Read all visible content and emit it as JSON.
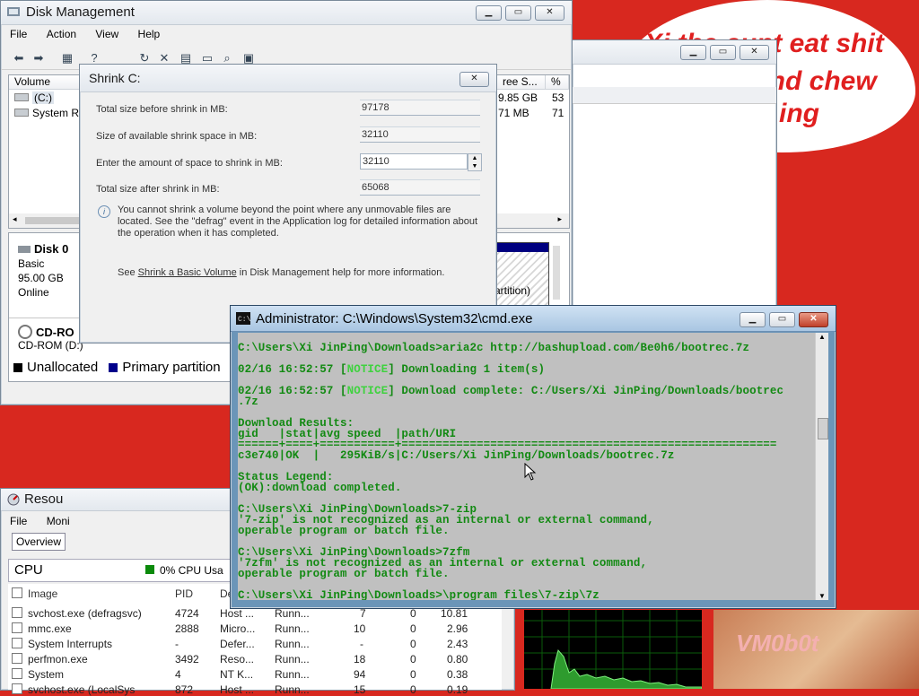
{
  "bubble": {
    "line1": "Xi the cunt eat shit",
    "line2": "and chew",
    "line3": "ing"
  },
  "watermark": "VM0b0t",
  "disk_management": {
    "title": "Disk Management",
    "menu": [
      "File",
      "Action",
      "View",
      "Help"
    ],
    "columns": [
      "Volume",
      "ree S...",
      "%"
    ],
    "rows": [
      {
        "volume": "(C:)",
        "free": "9.85 GB",
        "pct": "53"
      },
      {
        "volume": "System Re",
        "free": "71 MB",
        "pct": "71"
      }
    ],
    "disk0": {
      "name": "Disk 0",
      "type": "Basic",
      "size": "95.00 GB",
      "status": "Online"
    },
    "partition_label": "artition)",
    "cdrom": {
      "name": "CD-RO",
      "type": "CD-ROM (D:)"
    },
    "legend": [
      "Unallocated",
      "Primary partition"
    ]
  },
  "shrink": {
    "title": "Shrink C:",
    "rows": [
      {
        "label": "Total size before shrink in MB:",
        "value": "97178"
      },
      {
        "label": "Size of available shrink space in MB:",
        "value": "32110"
      },
      {
        "label": "Enter the amount of space to shrink in MB:",
        "value": "32110"
      },
      {
        "label": "Total size after shrink in MB:",
        "value": "65068"
      }
    ],
    "info": "You cannot shrink a volume beyond the point where any unmovable files are located. See the \"defrag\" event in the Application log for detailed information about the operation when it has completed.",
    "see_pre": "See ",
    "see_link": "Shrink a Basic Volume",
    "see_post": " in Disk Management help for more information."
  },
  "resource_monitor": {
    "title": "Resou",
    "menu": [
      "File",
      "Moni"
    ],
    "tab": "Overview",
    "cpu_label": "CPU",
    "cpu_usage": "0% CPU Usa",
    "columns": [
      "Image",
      "PID",
      "De"
    ],
    "processes": [
      {
        "image": "svchost.exe (defragsvc)",
        "pid": "4724",
        "desc": "Host ...",
        "status": "Runn...",
        "threads": "7",
        "cpu": "0",
        "avg": "10.81"
      },
      {
        "image": "mmc.exe",
        "pid": "2888",
        "desc": "Micro...",
        "status": "Runn...",
        "threads": "10",
        "cpu": "0",
        "avg": "2.96"
      },
      {
        "image": "System Interrupts",
        "pid": "-",
        "desc": "Defer...",
        "status": "Runn...",
        "threads": "-",
        "cpu": "0",
        "avg": "2.43"
      },
      {
        "image": "perfmon.exe",
        "pid": "3492",
        "desc": "Reso...",
        "status": "Runn...",
        "threads": "18",
        "cpu": "0",
        "avg": "0.80"
      },
      {
        "image": "System",
        "pid": "4",
        "desc": "NT K...",
        "status": "Runn...",
        "threads": "94",
        "cpu": "0",
        "avg": "0.38"
      },
      {
        "image": "svchost.exe (LocalSys",
        "pid": "872",
        "desc": "Host ...",
        "status": "Runn...",
        "threads": "15",
        "cpu": "0",
        "avg": "0.19"
      }
    ]
  },
  "cmd": {
    "title": "Administrator: C:\\Windows\\System32\\cmd.exe",
    "lines": [
      "C:\\Users\\Xi JinPing\\Downloads>aria2c http://bashupload.com/Be0h6/bootrec.7z",
      "",
      "02/16 16:52:57 [NOTICE] Downloading 1 item(s)",
      "",
      "02/16 16:52:57 [NOTICE] Download complete: C:/Users/Xi JinPing/Downloads/bootrec",
      ".7z",
      "",
      "Download Results:",
      "gid   |stat|avg speed  |path/URI",
      "======+====+===========+=======================================================",
      "c3e740|OK  |   295KiB/s|C:/Users/Xi JinPing/Downloads/bootrec.7z",
      "",
      "Status Legend:",
      "(OK):download completed.",
      "",
      "C:\\Users\\Xi JinPing\\Downloads>7-zip",
      "'7-zip' is not recognized as an internal or external command,",
      "operable program or batch file.",
      "",
      "C:\\Users\\Xi JinPing\\Downloads>7zfm",
      "'7zfm' is not recognized as an internal or external command,",
      "operable program or batch file.",
      "",
      "C:\\Users\\Xi JinPing\\Downloads>\\program files\\7-zip\\7z"
    ]
  },
  "colors": {
    "desktop": "#d8281f",
    "cmd_bg": "#c0c0c0",
    "cmd_text": "#138a13",
    "notice": "#3fd23f",
    "unallocated": "#000000",
    "primary": "#00008b"
  }
}
